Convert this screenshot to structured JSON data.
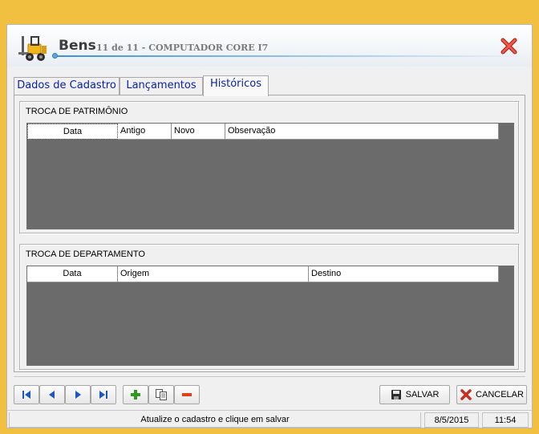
{
  "window": {
    "title": "Bens",
    "subtitle": "11 de 11 - COMPUTADOR CORE I7"
  },
  "tabs": [
    {
      "label": "Dados de Cadastro"
    },
    {
      "label": "Lançamentos"
    },
    {
      "label": "Históricos",
      "active": true
    }
  ],
  "patrimonio": {
    "title": "TROCA DE PATRIMÔNIO",
    "columns": [
      "Data",
      "Antigo",
      "Novo",
      "Observação"
    ]
  },
  "departamento": {
    "title": "TROCA DE DEPARTAMENTO",
    "columns": [
      "Data",
      "Origem",
      "Destino"
    ]
  },
  "actions": {
    "save": "SALVAR",
    "cancel": "CANCELAR"
  },
  "status": {
    "message": "Atualize o cadastro e clique em salvar",
    "date": "8/5/2015",
    "time": "11:54"
  },
  "colors": {
    "border": "#f2c040",
    "tab_text": "#0b22a8",
    "grid_bg": "#6b6b6b",
    "nav_icon": "#1d56c4",
    "add_icon": "#2e9a1e",
    "remove_icon": "#e0401a",
    "close_icon": "#d6342a"
  }
}
